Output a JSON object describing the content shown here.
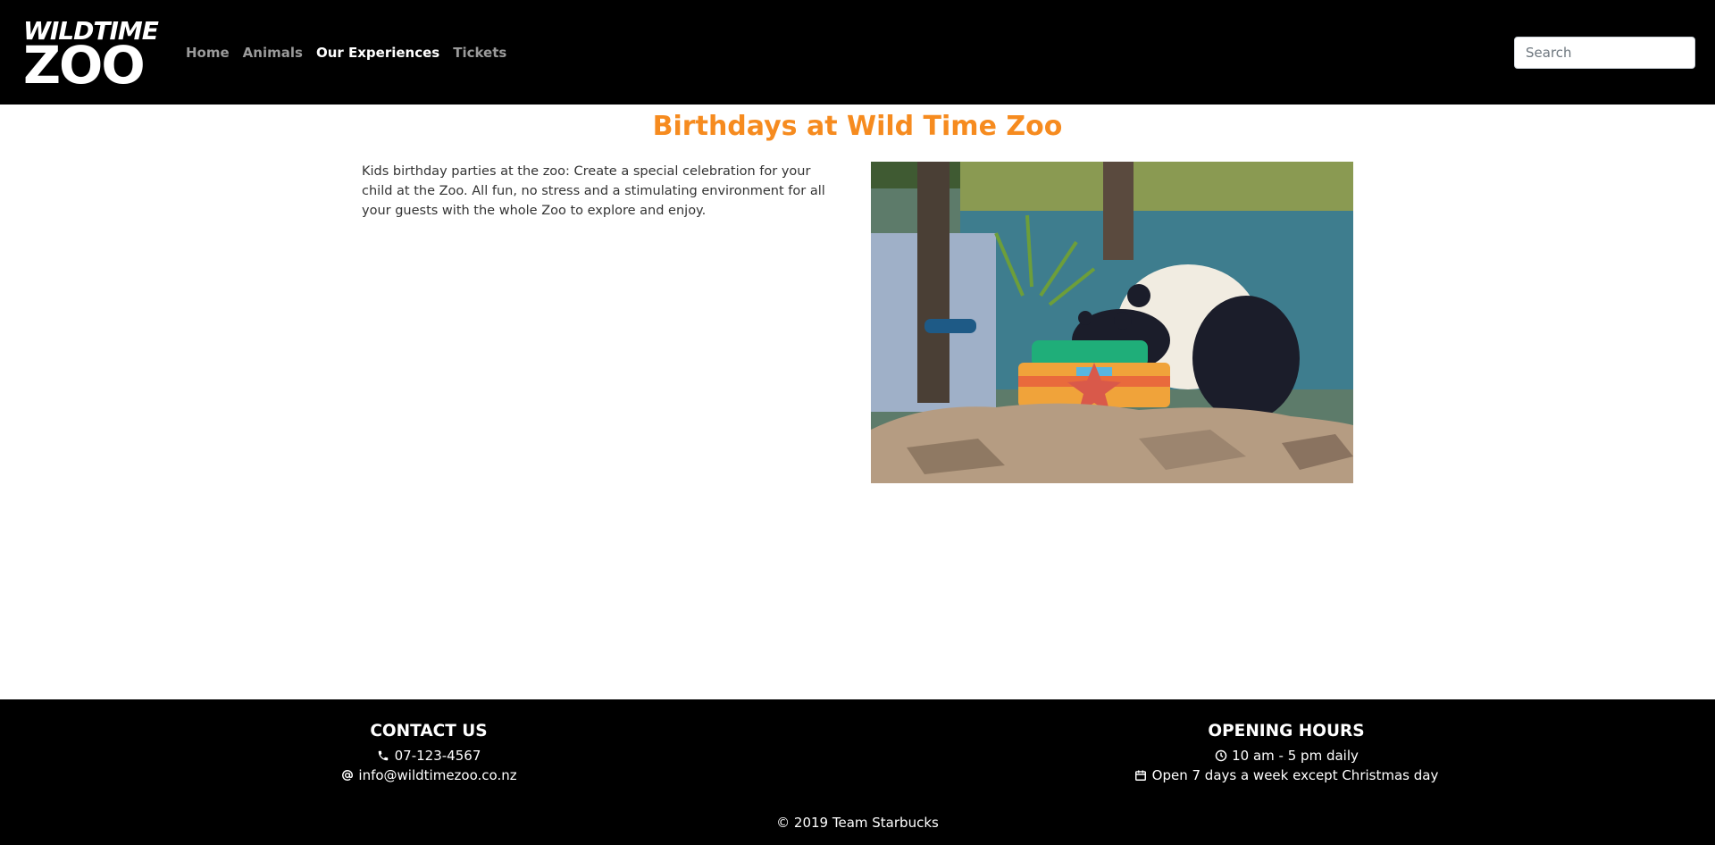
{
  "header": {
    "logo": {
      "line1": "WILDTIME",
      "line2": "ZOO"
    },
    "nav": [
      {
        "label": "Home",
        "active": false
      },
      {
        "label": "Animals",
        "active": false
      },
      {
        "label": "Our Experiences",
        "active": true
      },
      {
        "label": "Tickets",
        "active": false
      }
    ],
    "search": {
      "placeholder": "Search",
      "value": ""
    }
  },
  "main": {
    "title": "Birthdays at Wild Time Zoo",
    "intro": "Kids birthday parties at the zoo: Create a special celebration for your child at the Zoo. All fun, no stress and a stimulating environment for all your guests with the whole Zoo to explore and enjoy."
  },
  "footer": {
    "contact": {
      "heading": "CONTACT US",
      "phone": "07-123-4567",
      "email": "info@wildtimezoo.co.nz"
    },
    "hours": {
      "heading": "OPENING HOURS",
      "daily": "10 am - 5 pm daily",
      "days": "Open 7 days a week except Christmas day"
    },
    "copyright": "© 2019 Team Starbucks"
  },
  "colors": {
    "header_bg": "#000000",
    "accent_title": "#f68b1f",
    "nav_inactive": "#9a9a9a",
    "nav_active": "#ffffff"
  },
  "icons": [
    "phone-icon",
    "at-icon",
    "clock-icon",
    "calendar-icon"
  ]
}
